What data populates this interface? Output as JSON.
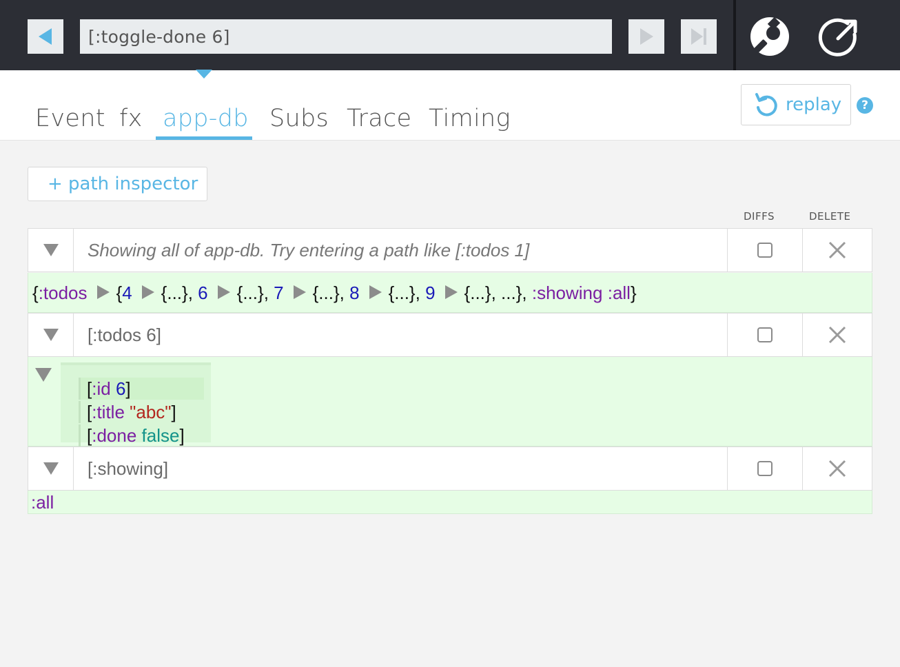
{
  "toolbar": {
    "event": "[:toggle-done 6]"
  },
  "tabs": [
    {
      "label": "Event",
      "active": false
    },
    {
      "label": "fx",
      "active": false
    },
    {
      "label": "app-db",
      "active": true
    },
    {
      "label": "Subs",
      "active": false
    },
    {
      "label": "Trace",
      "active": false
    },
    {
      "label": "Timing",
      "active": false
    }
  ],
  "replay": {
    "label": "replay"
  },
  "help": {
    "glyph": "?"
  },
  "path_inspector": {
    "label": "+ path inspector"
  },
  "columns": {
    "diffs": "DIFFS",
    "delete": "DELETE"
  },
  "paths": [
    {
      "path": "Showing all of app-db. Try entering a path like [:todos 1]",
      "is_hint": true,
      "diffs_checked": false
    },
    {
      "path": "[:todos 6]",
      "is_hint": false,
      "diffs_checked": false
    },
    {
      "path": "[:showing]",
      "is_hint": false,
      "diffs_checked": false
    }
  ],
  "results": {
    "app_db": {
      "open": "{",
      "todos_key": ":todos",
      "todo_ids": [
        "4",
        "6",
        "7",
        "8",
        "9"
      ],
      "collapsed": "{...}",
      "more": "...",
      "showing_key": ":showing",
      "showing_val": ":all",
      "close": "}"
    },
    "todo_6": {
      "id_key": ":id",
      "id_val": "6",
      "title_key": ":title",
      "title_val": "\"abc\"",
      "done_key": ":done",
      "done_val": "false"
    },
    "showing": ":all"
  },
  "colors": {
    "accent": "#58b6e4",
    "toolbar_bg": "#2c2e35",
    "result_bg": "#e6fde5",
    "keyword": "#7b1fa2",
    "number": "#1a1ab8",
    "string": "#b3261e",
    "boolean": "#13938a"
  },
  "icons": [
    "back-arrow-icon",
    "play-icon",
    "skip-end-icon",
    "settings-wrench-icon",
    "popout-icon",
    "replay-icon",
    "help-icon",
    "chevron-down-icon",
    "close-icon",
    "expand-right-icon"
  ]
}
